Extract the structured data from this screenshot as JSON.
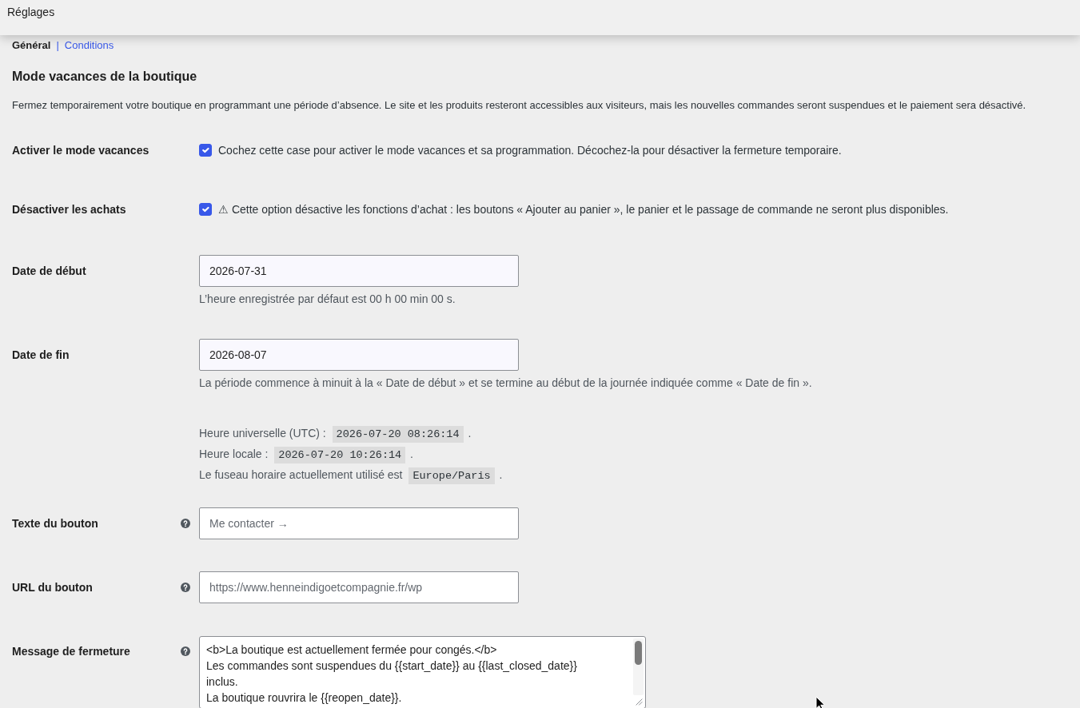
{
  "top_bar": {
    "title": "Réglages"
  },
  "tabs": [
    {
      "label": "Général",
      "selected": true
    },
    {
      "label": "Conditions",
      "selected": false
    }
  ],
  "tab_separator": "|",
  "section": {
    "title": "Mode vacances de la boutique",
    "description": "Fermez temporairement votre boutique en programmant une période d’absence. Le site et les produits resteront accessibles aux visiteurs, mais les nouvelles commandes seront suspendues et le paiement sera désactivé."
  },
  "fields": [
    {
      "kind": "checkbox",
      "label": "Activer le mode vacances",
      "help": false,
      "checked": true,
      "description": "Cochez cette case pour activer le mode vacances et sa programmation. Décochez-la pour désactiver la fermeture temporaire."
    },
    {
      "kind": "checkbox",
      "label": "Désactiver les achats",
      "help": false,
      "checked": true,
      "description": "⚠ Cette option désactive les fonctions d’achat : les boutons « Ajouter au panier », le panier et le passage de commande ne seront plus disponibles."
    },
    {
      "kind": "date",
      "label": "Date de début",
      "help": false,
      "value": "2026-07-31",
      "description": "L’heure enregistrée par défaut est 00 h 00 min 00 s."
    },
    {
      "kind": "date",
      "label": "Date de fin",
      "help": false,
      "value": "2026-08-07",
      "description": "La période commence à minuit à la « Date de début » et se termine au début de la journée indiquée comme « Date de fin ».",
      "time_info": [
        {
          "text": "Heure universelle (UTC) :",
          "code": "2026-07-20 08:26:14",
          "end": "."
        },
        {
          "text": "Heure locale :",
          "code": "2026-07-20 10:26:14",
          "end": "."
        },
        {
          "text": "Le fuseau horaire actuellement utilisé est",
          "code": "Europe/Paris",
          "end": "."
        }
      ]
    },
    {
      "kind": "text",
      "label": "Texte du bouton",
      "help": true,
      "placeholder": "Me contacter →"
    },
    {
      "kind": "text",
      "label": "URL du bouton",
      "help": true,
      "placeholder": "https://www.henneindigoetcompagnie.fr/wp"
    },
    {
      "kind": "textarea",
      "label": "Message de fermeture",
      "help": true,
      "lines": [
        "<b>La boutique est actuellement fermée pour congés.</b>",
        "Les commandes sont suspendues du {{start_date}} au {{last_closed_date}}",
        "inclus.",
        "La boutique rouvrira le {{reopen_date}}."
      ]
    }
  ]
}
